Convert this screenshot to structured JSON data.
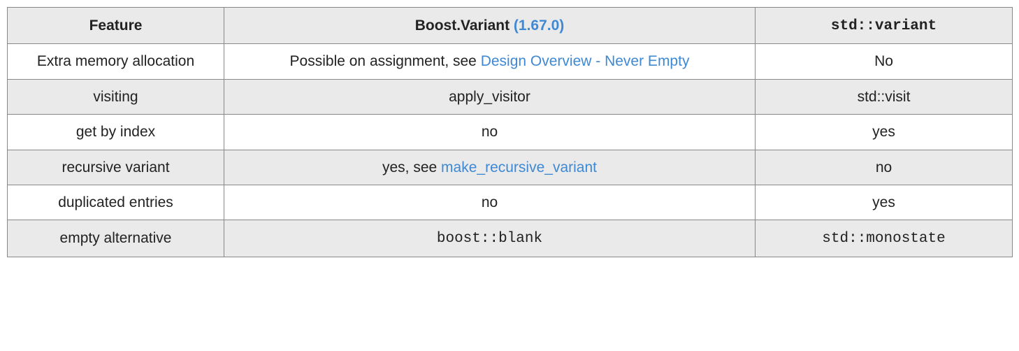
{
  "table": {
    "headers": {
      "feature": "Feature",
      "boost_prefix": "Boost.Variant ",
      "boost_version": "(1.67.0)",
      "std": "std::variant"
    },
    "rows": [
      {
        "feature": "Extra memory allocation",
        "boost_prefix": "Possible on assignment, see ",
        "boost_link": "Design Overview - Never Empty",
        "boost_suffix": "",
        "boost_mono": false,
        "std": "No",
        "std_mono": false
      },
      {
        "feature": "visiting",
        "boost_prefix": "apply_visitor",
        "boost_link": "",
        "boost_suffix": "",
        "boost_mono": false,
        "std": "std::visit",
        "std_mono": false
      },
      {
        "feature": "get by index",
        "boost_prefix": "no",
        "boost_link": "",
        "boost_suffix": "",
        "boost_mono": false,
        "std": "yes",
        "std_mono": false
      },
      {
        "feature": "recursive variant",
        "boost_prefix": "yes, see ",
        "boost_link": "make_recursive_variant",
        "boost_suffix": "",
        "boost_mono": false,
        "std": "no",
        "std_mono": false
      },
      {
        "feature": "duplicated entries",
        "boost_prefix": "no",
        "boost_link": "",
        "boost_suffix": "",
        "boost_mono": false,
        "std": "yes",
        "std_mono": false
      },
      {
        "feature": "empty alternative",
        "boost_prefix": "boost::blank",
        "boost_link": "",
        "boost_suffix": "",
        "boost_mono": true,
        "std": "std::monostate",
        "std_mono": true
      }
    ]
  }
}
